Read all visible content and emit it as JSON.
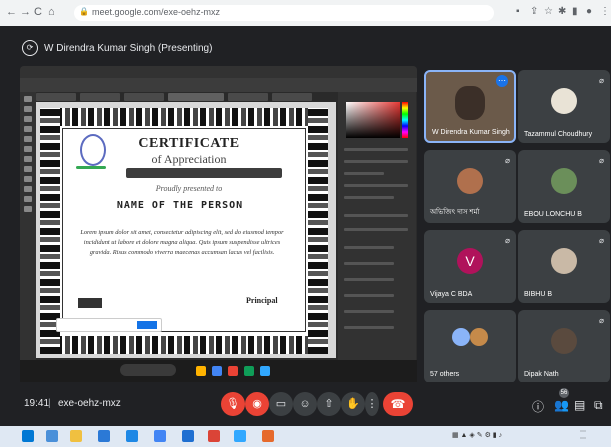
{
  "browser": {
    "url": "meet.google.com/exe-oehz-mxz",
    "nav_back": "←",
    "nav_forward": "→",
    "nav_reload": "C",
    "nav_home": "⌂",
    "lock": "🔒"
  },
  "presentation": {
    "presenter_label": "W Direndra Kumar Singh (Presenting)"
  },
  "certificate": {
    "title": "CERTIFICATE",
    "subtitle": "of Appreciation",
    "awarded_line": "Proudly presented to",
    "recipient": "NAME OF THE PERSON",
    "body": "Lorem ipsum dolor sit amet, consectetur adipiscing elit, sed do eiusmod tempor incididunt ut labore et dolore magna aliqua. Quis ipsum suspendisse ultrices gravida. Risus commodo viverra maecenas accumsan lacus vel facilisis.",
    "principal": "Principal"
  },
  "participants": [
    {
      "name": "W Direndra Kumar Singh"
    },
    {
      "name": "Tazammul Choudhury"
    },
    {
      "name": "অভিজিৎ দাস শর্মা"
    },
    {
      "name": "EBOU LONCHU B"
    },
    {
      "name": "Vijaya C BDA",
      "initial": "V",
      "avatar_color": "#b0125b"
    },
    {
      "name": "BIBHU B"
    },
    {
      "name": "57 others"
    },
    {
      "name": "Dipak Nath"
    }
  ],
  "meeting": {
    "time": "19:41",
    "separator": "|",
    "code": "exe-oehz-mxz",
    "badge_count": "56"
  },
  "colors": {
    "meet_bg": "#202124",
    "tile_bg": "#3c4043",
    "red": "#ea4335",
    "blue": "#1a73e8"
  }
}
